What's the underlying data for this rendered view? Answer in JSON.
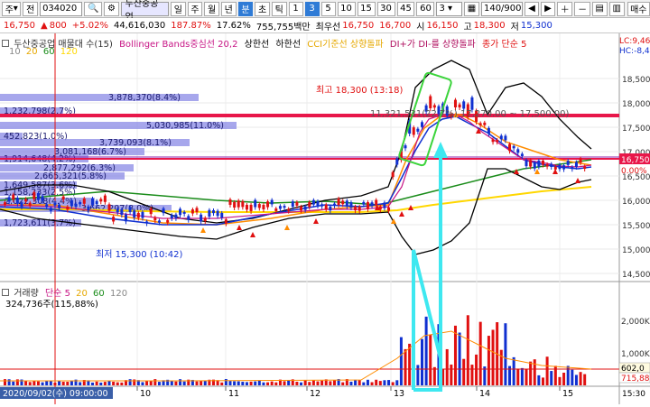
{
  "toolbar": {
    "type_label": "주",
    "jeon_label": "전",
    "code": "034020",
    "name": "두산중공업",
    "periods": [
      "일",
      "주",
      "월",
      "년",
      "분",
      "초",
      "틱"
    ],
    "numbers": [
      "1",
      "3",
      "5",
      "10",
      "15",
      "30",
      "45",
      "60"
    ],
    "selected_number": "3",
    "unit_value": "3",
    "count": "140/900",
    "right_label": "매수"
  },
  "info": {
    "price": "16,750",
    "change": "800",
    "change_pct": "+5.02%",
    "volume": "44,616,030",
    "turnover_pct": "187.87%",
    "v2": "17.62%",
    "amount": "755,755백만",
    "best_offer_label": "최우선",
    "best_offer": "16,750",
    "best_bid": "16,700",
    "open_label": "시",
    "open": "16,150",
    "high_label": "고",
    "high": "18,300",
    "low_label": "저",
    "low": "15,300"
  },
  "price_panel": {
    "legend_title": "두산중공업 매물대 수(15)",
    "legend_bb": "Bollinger Bands중심선 20,2",
    "legend_upper": "상한선",
    "legend_lower": "하한선",
    "legend_cci": "CCI기준선 상향돌파",
    "legend_di": "DI+가 DI-를 상향돌파",
    "legend_close": "종가 단순 5",
    "ma_labels": [
      "10",
      "20",
      "60",
      "120"
    ],
    "hl_label": "LC:9,46",
    "hc_label": "HC:-8,4",
    "max_label": "최고 18,300 (13:18)",
    "min_label": "최저 15,300 (10:42)",
    "current_price_tag": "16,750",
    "current_pct_tag": "0.00%",
    "range_label": "11,321,531(22.7%)  17,270.00 ~ 17,500.00)",
    "y_ticks": [
      "18,500",
      "18,000",
      "17,500",
      "17,000",
      "16,500",
      "16,000",
      "15,500",
      "15,000",
      "14,500"
    ],
    "volume_profile": [
      {
        "label": "3,878,370(8.4%)"
      },
      {
        "label": "1,232,798(2.7%)"
      },
      {
        "label": "5,030,985(11.0%)"
      },
      {
        "label": "452,823(1.0%)"
      },
      {
        "label": "3,739,093(8.1%)"
      },
      {
        "label": "3,081,168(6.7%)"
      },
      {
        "label": "1,914,648(4.2%)"
      },
      {
        "label": "2,877,292(6.3%)"
      },
      {
        "label": "2,665,321(5.8%)"
      },
      {
        "label": "1,649,587(3.6%)"
      },
      {
        "label": "1,158,233(2.5%)"
      },
      {
        "label": "2,022,308(4.4%)"
      },
      {
        "label": "3,662,207(8.0%)"
      },
      {
        "label": "1,723,611(3.7%)"
      }
    ]
  },
  "volume_panel": {
    "legend_title": "거래량",
    "legend_ma": "단순 5",
    "ma_labels": [
      "20",
      "60",
      "120"
    ],
    "value_label": "324,736주(115,88%)",
    "y_ticks": [
      "2,000K",
      "1,000K"
    ],
    "tag_602": "602,0",
    "tag_7": "715,88"
  },
  "xaxis": {
    "date_label": "2020/09/02(수) 09:00:00",
    "ticks": [
      "10",
      "11",
      "12",
      "13",
      "14",
      "15"
    ],
    "right_corner": "15:30"
  },
  "colors": {
    "up": "#e01010",
    "down": "#1030d0",
    "hline": "#e8174a",
    "profile": "#8a8ae6",
    "ma5": "#ff8c00",
    "ma20": "#1a8c1a",
    "upper": "#000000",
    "annotation": "#3ee8f0"
  }
}
